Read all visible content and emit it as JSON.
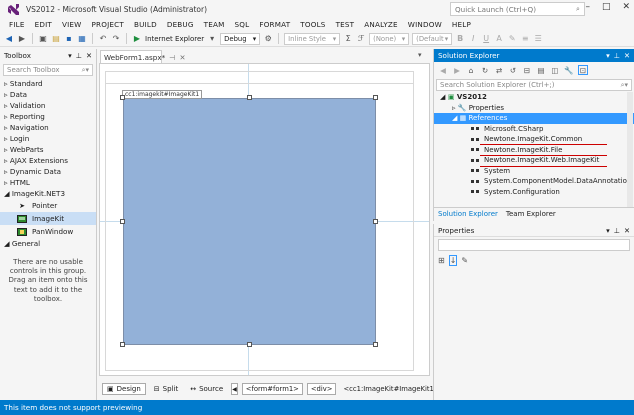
{
  "window": {
    "title": "VS2012 - Microsoft Visual Studio (Administrator)",
    "logo": "vs-logo-icon",
    "quick_launch_placeholder": "Quick Launch (Ctrl+Q)",
    "controls": [
      "minimize-icon",
      "maximize-icon",
      "close-icon"
    ]
  },
  "menu": [
    "FILE",
    "EDIT",
    "VIEW",
    "PROJECT",
    "BUILD",
    "DEBUG",
    "TEAM",
    "SQL",
    "FORMAT",
    "TOOLS",
    "TEST",
    "ANALYZE",
    "WINDOW",
    "HELP"
  ],
  "toolbar": {
    "run_label": "Internet Explorer",
    "config": "Debug",
    "style_combo": "Inline Style",
    "font_combo": "(None)",
    "size_combo": "(Default"
  },
  "toolbox": {
    "title": "Toolbox",
    "search_placeholder": "Search Toolbox",
    "categories": [
      "Standard",
      "Data",
      "Validation",
      "Reporting",
      "Navigation",
      "Login",
      "WebParts",
      "AJAX Extensions",
      "Dynamic Data",
      "HTML"
    ],
    "expanded_category": "ImageKit.NET3",
    "items": [
      {
        "label": "Pointer",
        "icon": "pointer-icon"
      },
      {
        "label": "ImageKit",
        "icon": "imagekit-icon"
      },
      {
        "label": "PanWindow",
        "icon": "panwindow-icon"
      }
    ],
    "general_category": "General",
    "empty_message": "There are no usable controls in this group. Drag an item onto this text to add it to the toolbox."
  },
  "document": {
    "tab_label": "WebForm1.aspx*",
    "control_tag": "cc1:imagekit#ImageKit1",
    "view_buttons": [
      "Design",
      "Split",
      "Source"
    ],
    "breadcrumbs": [
      "<form#form1>",
      "<div>",
      "<cc1:ImageKit#ImageKit1>"
    ]
  },
  "solution_explorer": {
    "title": "Solution Explorer",
    "search_placeholder": "Search Solution Explorer (Ctrl+;)",
    "project": "VS2012",
    "properties_node": "Properties",
    "references_node": "References",
    "references": [
      "Microsoft.CSharp",
      "Newtone.ImageKit.Common",
      "Newtone.ImageKit.File",
      "Newtone.ImageKit.Web.ImageKit",
      "System",
      "System.ComponentModel.DataAnnotatio",
      "System.Configuration"
    ],
    "tabs": [
      "Solution Explorer",
      "Team Explorer"
    ]
  },
  "properties": {
    "title": "Properties"
  },
  "status": {
    "text": "This item does not support previewing"
  },
  "colors": {
    "accent": "#007acc",
    "imagekit_fill": "#93b1d8",
    "selection": "#3399ff",
    "underline": "#cc0000"
  }
}
